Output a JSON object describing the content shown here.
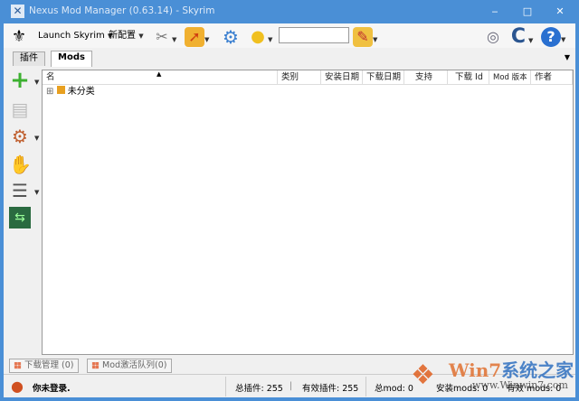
{
  "window": {
    "title": "Nexus Mod Manager (0.63.14) - Skyrim",
    "minimize": "‒",
    "maximize": "□",
    "close": "✕"
  },
  "toolbar": {
    "launch": "Launch Skyrim",
    "profile": "新配置",
    "search_value": ""
  },
  "tabs": [
    {
      "label": "插件"
    },
    {
      "label": "Mods"
    }
  ],
  "columns": [
    "名",
    "类别",
    "安装日期",
    "下载日期",
    "支持",
    "下载 Id",
    "Mod 版本",
    "作者"
  ],
  "rows": [
    {
      "label": "未分类",
      "expander": "⊞"
    }
  ],
  "bottom_tabs": [
    {
      "label": "下载管理 (0)"
    },
    {
      "label": "Mod激活队列(0)"
    }
  ],
  "status": {
    "login": "你未登录.",
    "total_plugins": "总插件: 255",
    "sep": "|",
    "active_plugins": "有效插件:  255",
    "total_mods": "总mod: 0",
    "installed_mods": "安装mods: 0",
    "active_mods": "有效 mods: 0"
  },
  "watermark": {
    "text": "Win7系统之家",
    "url": "www.Winwin7.com"
  }
}
